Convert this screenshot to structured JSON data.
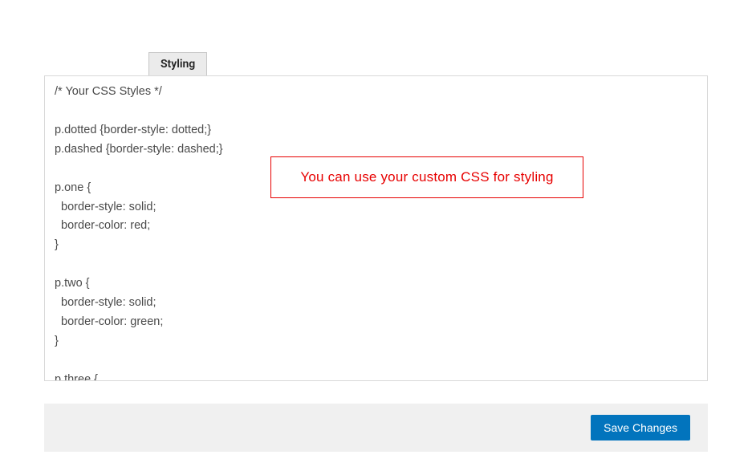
{
  "tab": {
    "label": "Styling"
  },
  "editor": {
    "css_value": "/* Your CSS Styles */\n\np.dotted {border-style: dotted;}\np.dashed {border-style: dashed;}\n\np.one {\n  border-style: solid;\n  border-color: red;\n}\n\np.two {\n  border-style: solid;\n  border-color: green;\n}\n\np.three {\n  border-style: dotted;"
  },
  "callout": {
    "text": "You can use your custom CSS for styling"
  },
  "footer": {
    "save_label": "Save Changes"
  }
}
